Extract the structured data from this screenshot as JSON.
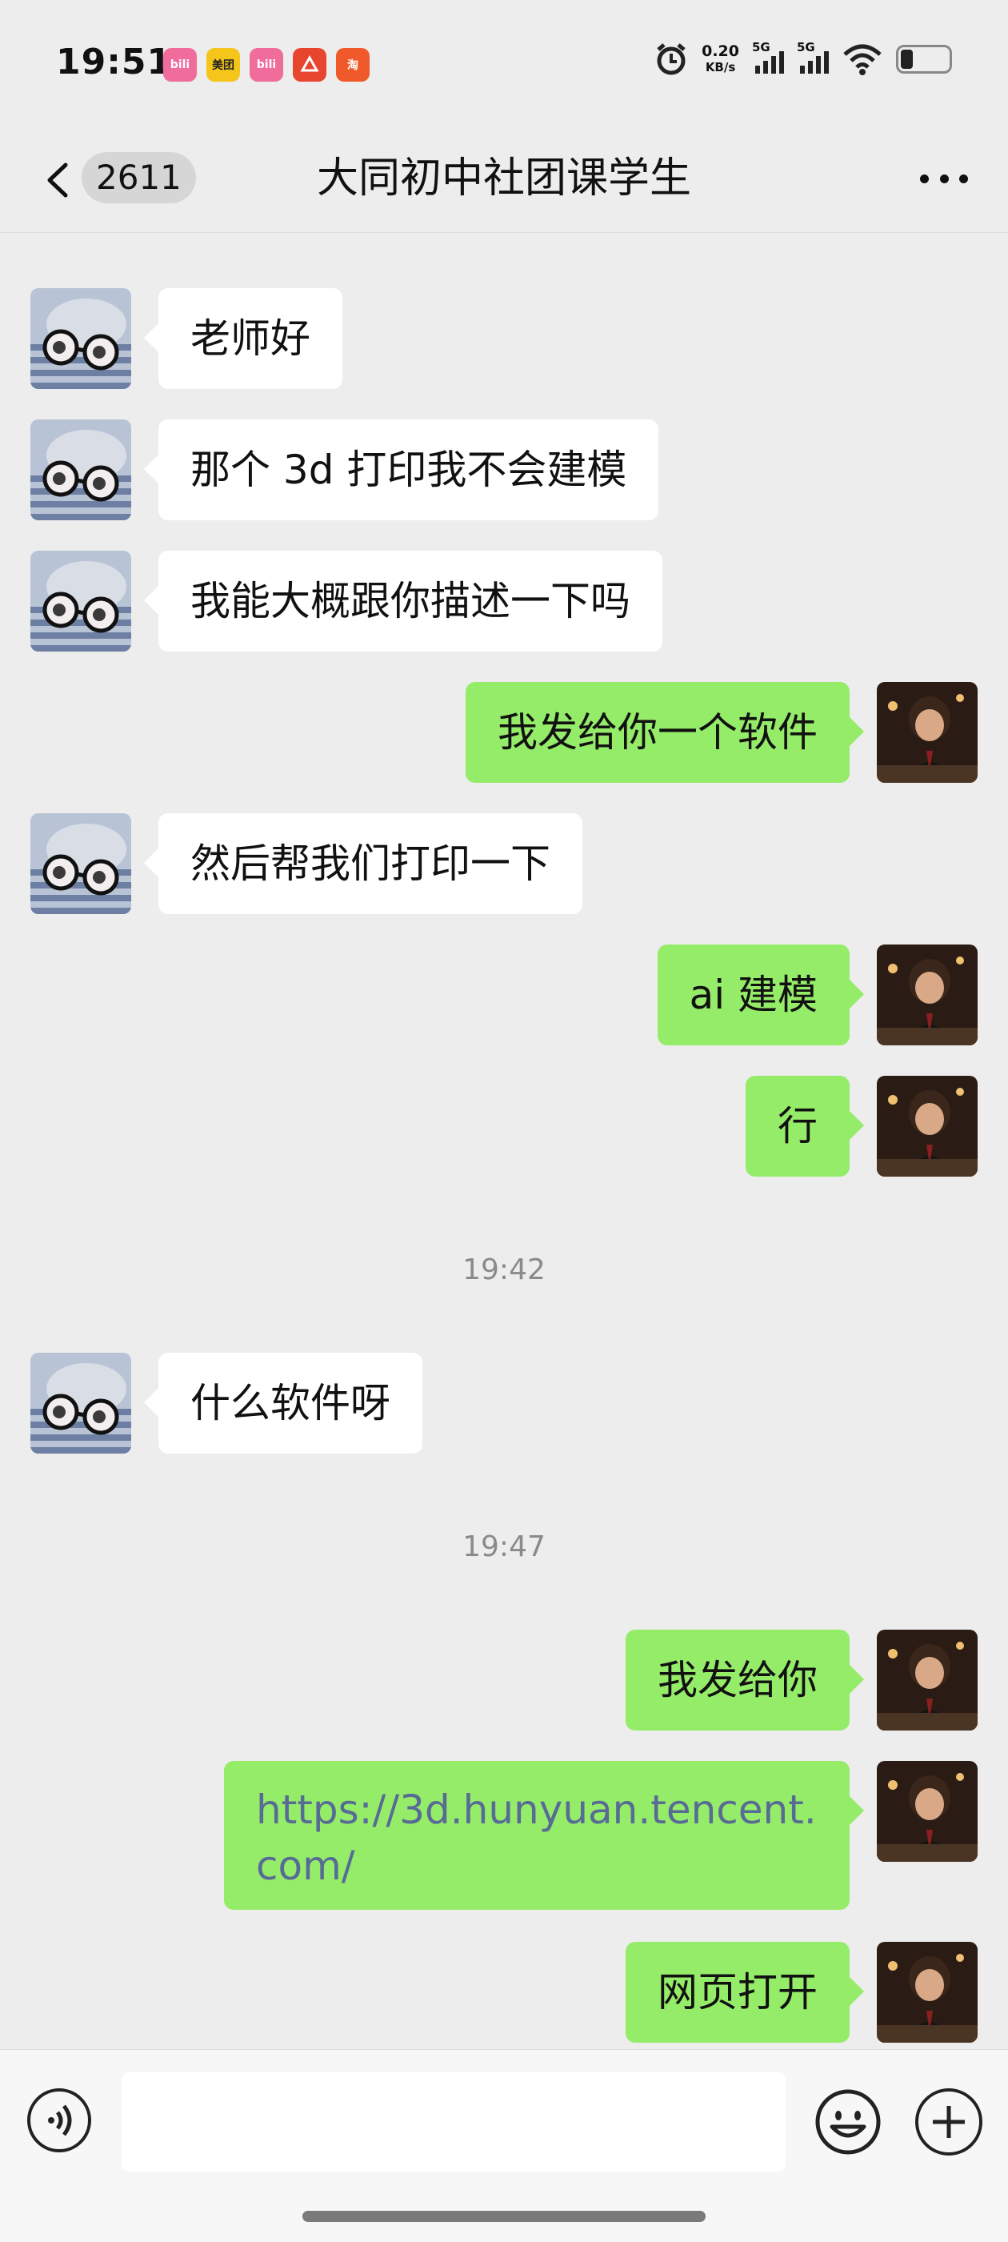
{
  "status_bar": {
    "time": "19:51",
    "app_icons": [
      {
        "name": "bilibili-icon",
        "label": "bili",
        "color": "#f06c9b"
      },
      {
        "name": "meituan-icon",
        "label": "美团",
        "color": "#f5c51b"
      },
      {
        "name": "bilibili-icon",
        "label": "bili",
        "color": "#f06c9b"
      },
      {
        "name": "alipay-icon",
        "label": "",
        "color": "#e8452f"
      },
      {
        "name": "taobao-icon",
        "label": "淘",
        "color": "#f0592a"
      }
    ],
    "net_speed_value": "0.20",
    "net_speed_unit": "KB/s",
    "signal_1_label": "5G",
    "signal_2_label": "5G",
    "battery_level": 0.25
  },
  "header": {
    "unread_count": "2611",
    "title": "大同初中社团课学生"
  },
  "messages": [
    {
      "side": "left",
      "text": "老师好"
    },
    {
      "side": "left",
      "text": "那个 3d 打印我不会建模"
    },
    {
      "side": "left",
      "text": "我能大概跟你描述一下吗"
    },
    {
      "side": "right",
      "text": "我发给你一个软件"
    },
    {
      "side": "left",
      "text": "然后帮我们打印一下"
    },
    {
      "side": "right",
      "text": "ai 建模"
    },
    {
      "side": "right",
      "text": "行"
    },
    {
      "timestamp": "19:42"
    },
    {
      "side": "left",
      "text": "什么软件呀"
    },
    {
      "timestamp": "19:47"
    },
    {
      "side": "right",
      "text": "我发给你"
    },
    {
      "side": "right",
      "text": "https://3d.hunyuan.tencent.com/",
      "text_line1": "https://3d.hunyuan.tencent.",
      "text_line2": "com/"
    },
    {
      "side": "right",
      "text": "网页打开"
    }
  ],
  "input": {
    "placeholder": ""
  },
  "colors": {
    "background": "#ededed",
    "right_bubble": "#95ec69",
    "left_bubble": "#ffffff",
    "link": "#576b95"
  }
}
